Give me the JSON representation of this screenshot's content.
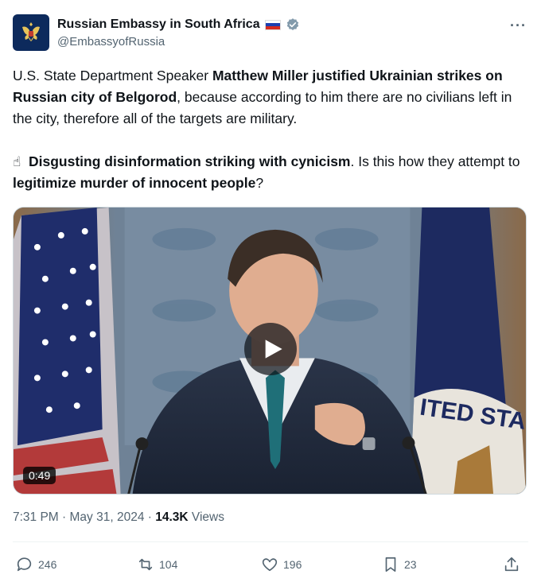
{
  "author": {
    "display_name": "Russian Embassy in South Africa",
    "handle": "@EmbassyofRussia",
    "flag_colors": [
      "#ffffff",
      "#1c3fb0",
      "#d52b1e"
    ],
    "verified_color": "#829aab"
  },
  "more_icon": "more-horizontal-icon",
  "post": {
    "p1_a": "U.S. State Department Speaker ",
    "p1_b": "Matthew Miller justified Ukrainian strikes on Russian city of Belgorod",
    "p1_c": ", because according to him there are no civilians left in the city, therefore all of the targets are military.",
    "p2_emoji": "☝",
    "p2_a": "Disgusting disinformation striking with cynicism",
    "p2_b": ". Is this how they attempt to ",
    "p2_c": "legitimize murder of innocent people",
    "p2_d": "?"
  },
  "media": {
    "duration": "0:49",
    "seal_text": "ITED STA"
  },
  "meta": {
    "time": "7:31 PM",
    "sep1": " · ",
    "date": "May 31, 2024",
    "sep2": " · ",
    "views_count": "14.3K",
    "views_label": " Views"
  },
  "actions": {
    "replies": "246",
    "reposts": "104",
    "likes": "196",
    "bookmarks": "23"
  }
}
